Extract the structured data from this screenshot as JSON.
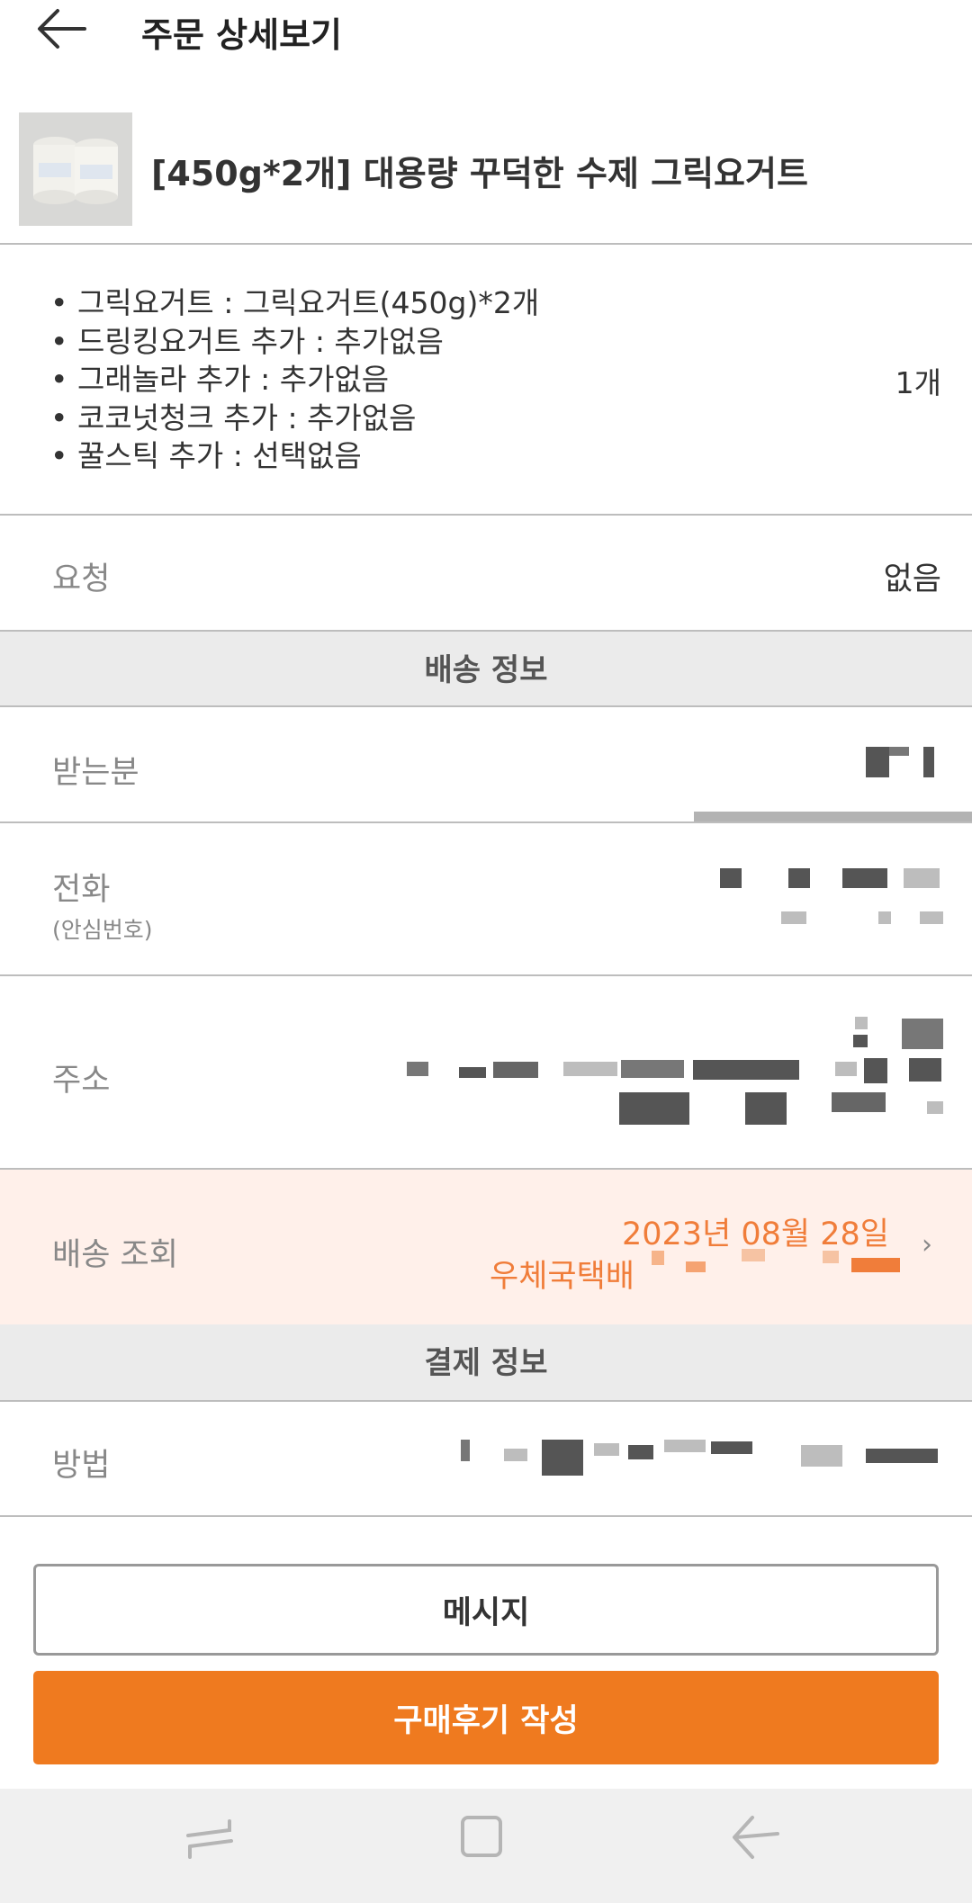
{
  "header": {
    "title": "주문 상세보기",
    "back_icon": "arrow-left-icon"
  },
  "product": {
    "name": "[450g*2개] 대용량 꾸덕한 수제 그릭요거트",
    "options": [
      "그릭요거트  : 그릭요거트(450g)*2개",
      "드링킹요거트 추가 : 추가없음",
      "그래놀라  추가 : 추가없음",
      "코코넛청크 추가 : 추가없음",
      "꿀스틱 추가 : 선택없음"
    ],
    "quantity": "1개"
  },
  "request": {
    "label": "요청",
    "value": "없음"
  },
  "shipping_info": {
    "section_title": "배송 정보",
    "recipient_label": "받는분",
    "phone_label": "전화",
    "phone_sublabel": "(안심번호)",
    "address_label": "주소"
  },
  "tracking": {
    "label": "배송 조회",
    "date": "2023년 08월 28일",
    "carrier": "우체국택배"
  },
  "payment_info": {
    "section_title": "결제 정보",
    "method_label": "방법"
  },
  "actions": {
    "message_label": "메시지",
    "review_label": "구매후기 작성"
  },
  "colors": {
    "accent": "#ef7a1f",
    "tracking_bg": "#fff0ea",
    "tracking_text": "#f07d3a",
    "section_bg": "#ebebeb"
  }
}
